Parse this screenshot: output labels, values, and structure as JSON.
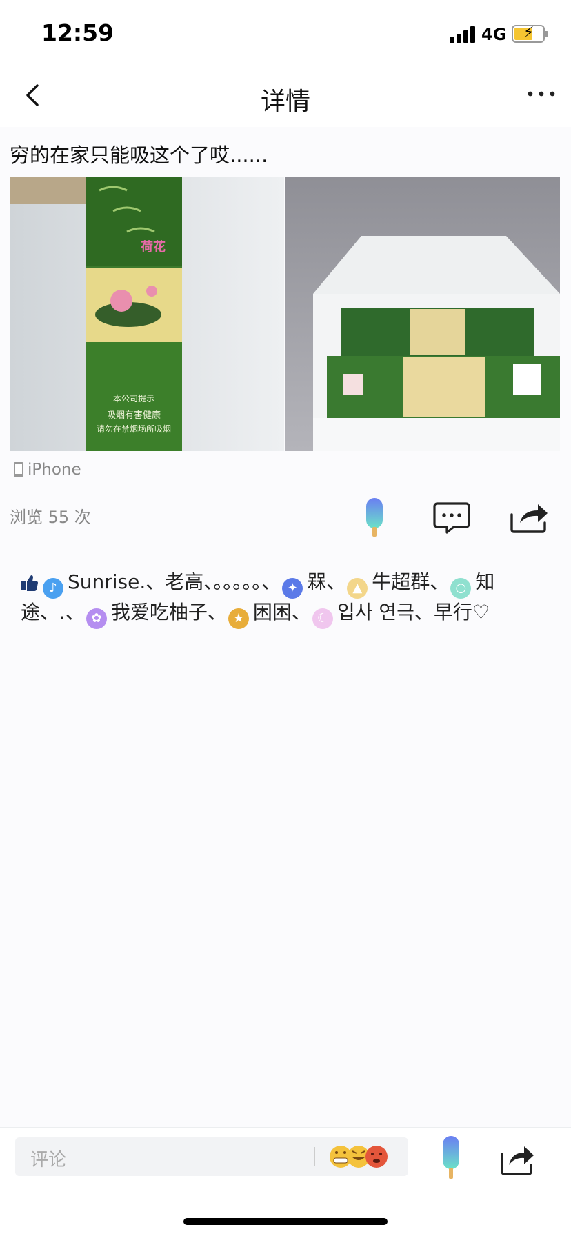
{
  "status_bar": {
    "time": "12:59",
    "network": "4G",
    "signal_bars": 4,
    "battery_level": 0.6,
    "charging": true
  },
  "nav": {
    "title": "详情"
  },
  "post": {
    "text": "穷的在家只能吸这个了哎......",
    "images": [
      {
        "package_texts": [
          "本公司提示",
          "吸烟有害健康",
          "请勿在禁烟场所吸烟"
        ]
      },
      {
        "package_texts": []
      }
    ],
    "device": "iPhone",
    "views": "浏览 55 次"
  },
  "likes": {
    "line1": [
      {
        "avatar_icon": "bell-avatar",
        "avatar_color": "#4aa0f0",
        "label": "Sunrise.、老高、。。。。。、"
      },
      {
        "avatar_icon": "bird-avatar",
        "avatar_color": "#5b7ae8",
        "label": "槑、"
      },
      {
        "avatar_icon": "triangle-avatar",
        "avatar_color": "#f3d68a",
        "label": "牛超群、"
      },
      {
        "avatar_icon": "circle-avatar",
        "avatar_color": "#8fe0cf",
        "label": "知"
      }
    ],
    "line2_prefix": "途、.、",
    "line2": [
      {
        "avatar_icon": "fish-avatar",
        "avatar_color": "#b58ef0",
        "label": "我爱吃柚子、"
      },
      {
        "avatar_icon": "star-avatar",
        "avatar_color": "#e8ad3a",
        "label": "困困、"
      },
      {
        "avatar_icon": "moon-avatar",
        "avatar_color": "#f0c6ee",
        "label": "입사 연극、早行♡"
      }
    ]
  },
  "bottom_bar": {
    "comment_placeholder": "评论"
  },
  "colors": {
    "accent_blue": "#4aa0f0",
    "like_gradient_top": "#6a7ef2",
    "like_gradient_bottom": "#6be2c8"
  }
}
